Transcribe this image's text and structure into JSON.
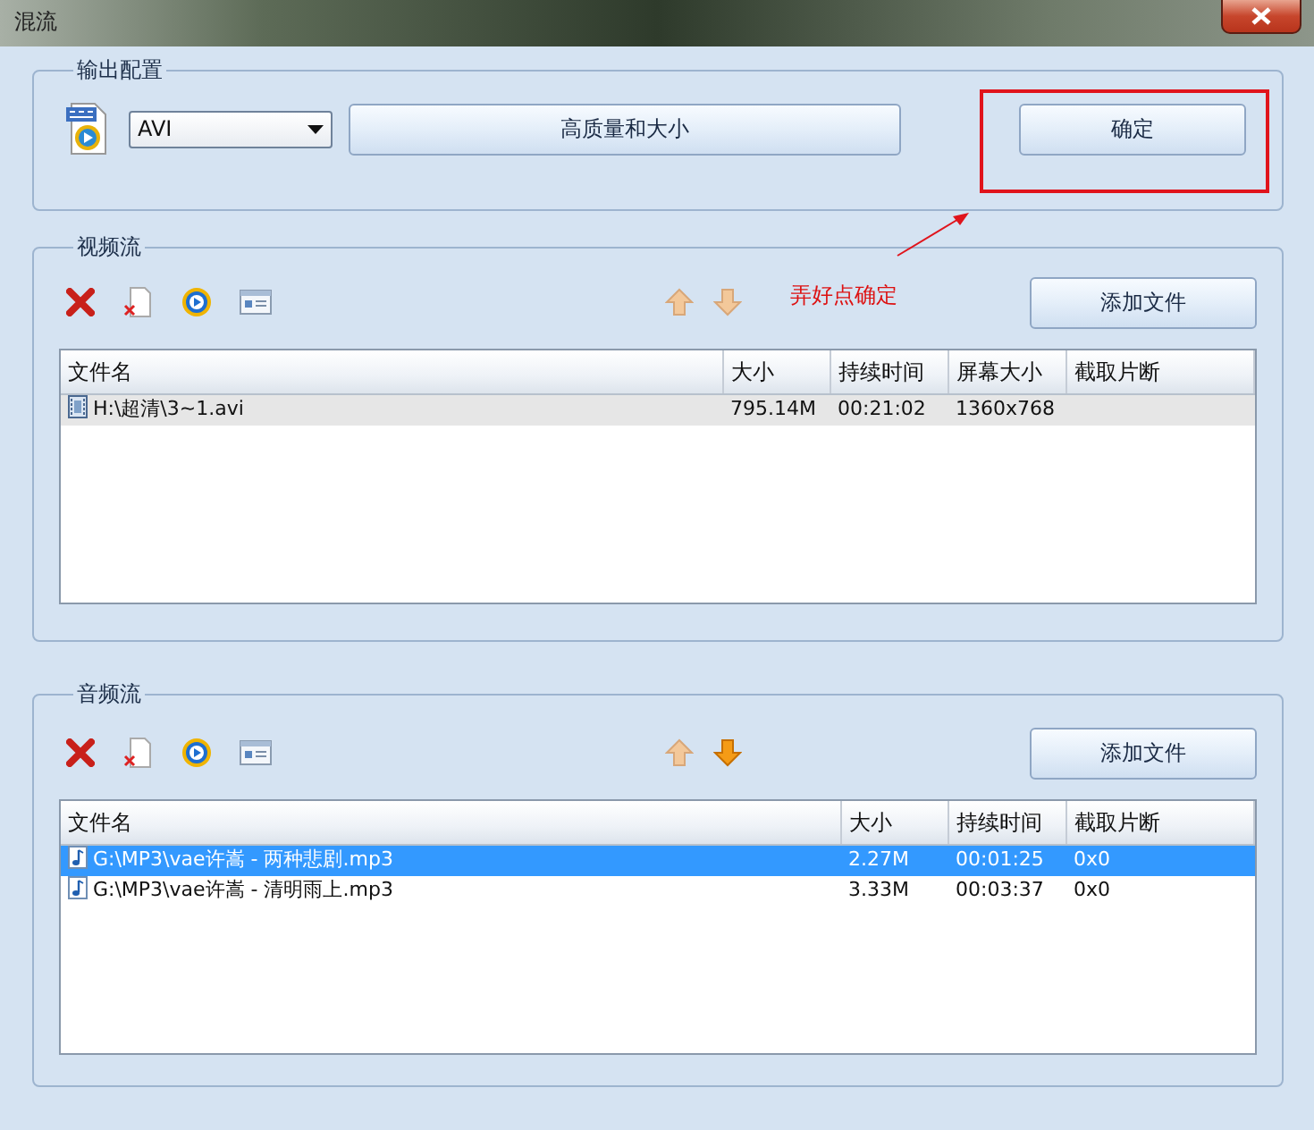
{
  "window": {
    "title": "混流"
  },
  "output_config": {
    "title": "输出配置",
    "format": "AVI",
    "quality_button": "高质量和大小",
    "ok_button": "确定"
  },
  "annotation": {
    "text": "弄好点确定"
  },
  "video_stream": {
    "title": "视频流",
    "move_up_enabled": false,
    "move_down_enabled": false,
    "add_button": "添加文件",
    "table": {
      "focused": false,
      "columns": [
        "文件名",
        "大小",
        "持续时间",
        "屏幕大小",
        "截取片断"
      ],
      "rows": [
        {
          "kind": "video",
          "selected": true,
          "cells": [
            "H:\\超清\\3~1.avi",
            "795.14M",
            "00:21:02",
            "1360x768",
            ""
          ]
        }
      ]
    }
  },
  "audio_stream": {
    "title": "音频流",
    "move_up_enabled": false,
    "move_down_enabled": true,
    "add_button": "添加文件",
    "table": {
      "focused": true,
      "columns": [
        "文件名",
        "大小",
        "持续时间",
        "截取片断"
      ],
      "rows": [
        {
          "kind": "audio",
          "selected": true,
          "cells": [
            "G:\\MP3\\vae许嵩 - 两种悲剧.mp3",
            "2.27M",
            "00:01:25",
            "0x0"
          ]
        },
        {
          "kind": "audio",
          "selected": false,
          "cells": [
            "G:\\MP3\\vae许嵩 - 清明雨上.mp3",
            "3.33M",
            "00:03:37",
            "0x0"
          ]
        }
      ]
    }
  }
}
